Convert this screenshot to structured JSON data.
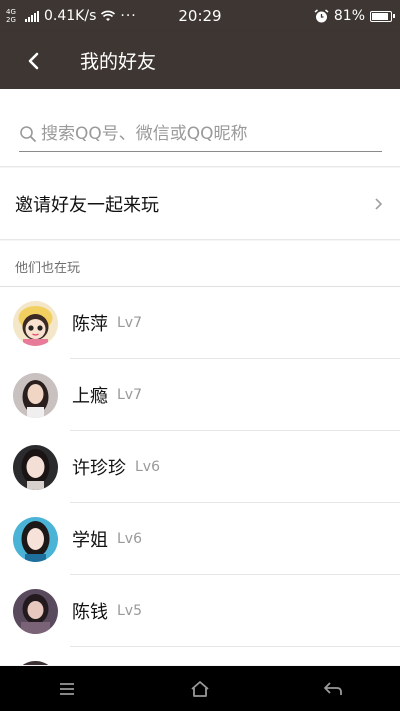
{
  "status_bar": {
    "network_type": "4G\n2G",
    "speed": "0.41K/s",
    "dots": "···",
    "time": "20:29",
    "battery": "81%",
    "battery_level": 0.81
  },
  "header": {
    "back_icon": "chevron-left-icon",
    "title": "我的好友"
  },
  "search": {
    "icon": "search-icon",
    "placeholder": "搜索QQ号、微信或QQ昵称",
    "value": ""
  },
  "invite": {
    "label": "邀请好友一起来玩",
    "icon": "chevron-right-icon"
  },
  "section": {
    "title": "他们也在玩"
  },
  "friends": [
    {
      "name": "陈萍",
      "level": "Lv7"
    },
    {
      "name": "上瘾",
      "level": "Lv7"
    },
    {
      "name": "许珍珍",
      "level": "Lv6"
    },
    {
      "name": "学姐",
      "level": "Lv6"
    },
    {
      "name": "陈钱",
      "level": "Lv5"
    },
    {
      "name": "",
      "level": ""
    }
  ],
  "nav_bar": {
    "items": [
      "menu-icon",
      "home-icon",
      "back-arrow-icon"
    ]
  },
  "colors": {
    "header_bg": "#3d3633",
    "page_bg": "#f5f5f5",
    "text_primary": "#111111",
    "text_secondary": "#999999"
  }
}
